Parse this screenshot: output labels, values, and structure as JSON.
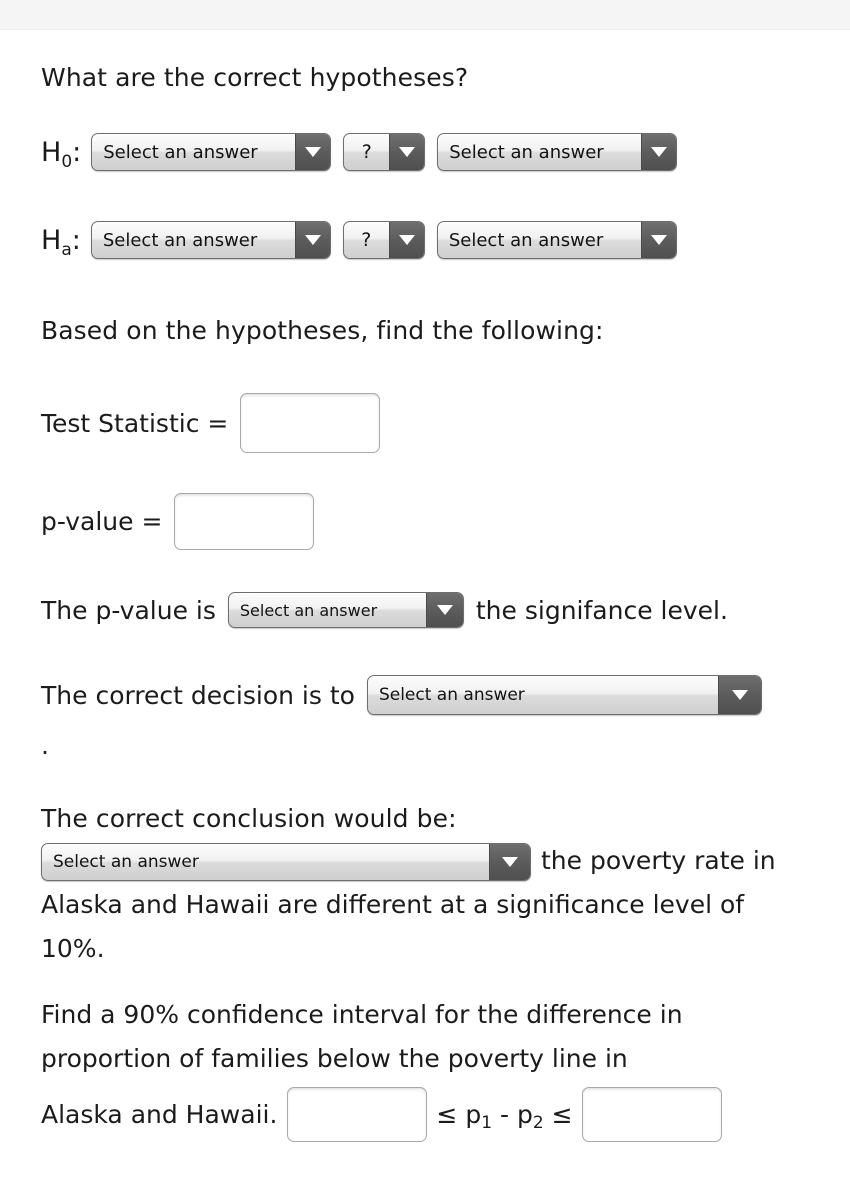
{
  "topbar": {
    "visible": true
  },
  "questions": {
    "hypotheses_prompt": "What are the correct hypotheses?",
    "h0_label": "H",
    "h0_sub": "0",
    "h0_colon": ":",
    "ha_label": "H",
    "ha_sub": "a",
    "ha_colon": ":",
    "based_on_prompt": "Based on the hypotheses, find the following:",
    "test_statistic_label": "Test Statistic =",
    "p_value_label": "p-value =",
    "p_value_is_prefix": "The p-value is",
    "p_value_is_suffix": "the signifance level.",
    "decision_prefix": "The correct decision is to",
    "lone_period": ".",
    "conclusion_prompt": "The correct conclusion would be:",
    "conclusion_suffix": "the poverty rate in Alaska and Hawaii are different at a significance level of 10%.",
    "find_ci_text": "Find a 90% confidence interval for the difference in proportion of families below the poverty line in Alaska and Hawaii.",
    "ci_operator_left": "≤",
    "ci_param_p": "p",
    "ci_param_sub1": "1",
    "ci_minus": "-",
    "ci_param_sub2": "2",
    "ci_operator_right": "≤"
  },
  "selects": {
    "placeholder": "Select an answer",
    "unknown_placeholder": "?",
    "arrow_icon": "chevron-down-icon",
    "h0_left_value": "Select an answer",
    "h0_middle_value": "?",
    "h0_right_value": "Select an answer",
    "ha_left_value": "Select an answer",
    "ha_middle_value": "?",
    "ha_right_value": "Select an answer",
    "pvalue_comparison_value": "Select an answer",
    "decision_value": "Select an answer",
    "conclusion_value": "Select an answer"
  },
  "inputs": {
    "test_statistic_value": "",
    "test_statistic_placeholder": "",
    "p_value_value": "",
    "p_value_placeholder": "",
    "ci_lower_value": "",
    "ci_lower_placeholder": "",
    "ci_upper_value": "",
    "ci_upper_placeholder": ""
  },
  "colors": {
    "page_background": "#ffffff",
    "topbar_background": "#f5f5f6",
    "text": "#1b1b1b",
    "select_border": "#6e6e6e",
    "select_arrow_background": "#5c5c5c",
    "select_arrow_glyph": "#ffffff",
    "input_border": "#a9a9a9"
  }
}
